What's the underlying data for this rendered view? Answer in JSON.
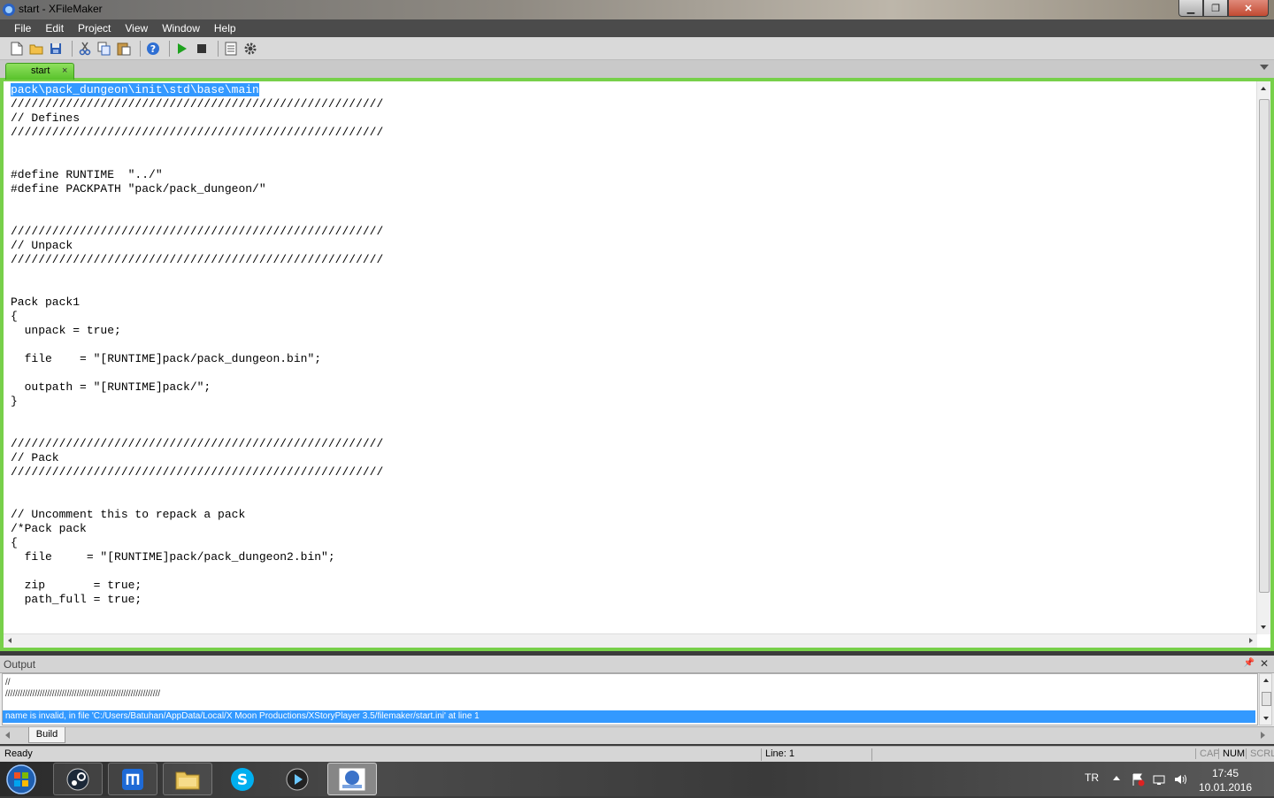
{
  "window": {
    "title": "start - XFileMaker",
    "controls": [
      "minimize",
      "maximize",
      "close"
    ]
  },
  "menu": [
    "File",
    "Edit",
    "Project",
    "View",
    "Window",
    "Help"
  ],
  "toolbar": {
    "icons": [
      "new-file-icon",
      "open-folder-icon",
      "save-icon",
      "cut-icon",
      "copy-icon",
      "paste-icon",
      "help-icon",
      "run-icon",
      "stop-icon",
      "file-list-icon",
      "settings-gear-icon"
    ],
    "run_color": "#1ea21e"
  },
  "tabs": [
    {
      "label": "start",
      "close": "×",
      "active": true
    }
  ],
  "editor": {
    "selected_line": "pack\\pack_dungeon\\init\\std\\base\\main",
    "lines": [
      "pack\\pack_dungeon\\init\\std\\base\\main",
      "//////////////////////////////////////////////////////",
      "// Defines",
      "//////////////////////////////////////////////////////",
      "",
      "",
      "#define RUNTIME  \"../\"",
      "#define PACKPATH \"pack/pack_dungeon/\"",
      "",
      "",
      "//////////////////////////////////////////////////////",
      "// Unpack",
      "//////////////////////////////////////////////////////",
      "",
      "",
      "Pack pack1",
      "{",
      "  unpack = true;",
      "",
      "  file    = \"[RUNTIME]pack/pack_dungeon.bin\";",
      "",
      "  outpath = \"[RUNTIME]pack/\";",
      "}",
      "",
      "",
      "//////////////////////////////////////////////////////",
      "// Pack",
      "//////////////////////////////////////////////////////",
      "",
      "",
      "// Uncomment this to repack a pack",
      "/*Pack pack",
      "{",
      "  file     = \"[RUNTIME]pack/pack_dungeon2.bin\";",
      "",
      "  zip       = true;",
      "  path_full = true;"
    ]
  },
  "output": {
    "title": "Output",
    "lines": [
      "//",
      "///////////////////////////////////////////////////////////////"
    ],
    "error": "name is invalid, in file 'C:/Users/Batuhan/AppData/Local/X Moon Productions/XStoryPlayer 3.5/filemaker/start.ini' at line 1",
    "tabs": [
      "Build"
    ]
  },
  "status": {
    "ready": "Ready",
    "line": "Line: 1",
    "cap": "CAP",
    "num": "NUM",
    "scrl": "SCRL"
  },
  "taskbar": {
    "apps": [
      "steam-icon",
      "maxthon-icon",
      "file-explorer-icon",
      "skype-icon",
      "media-player-icon",
      "xfilemaker-icon"
    ],
    "active_app": "xfilemaker-icon",
    "tray": {
      "lang": "TR",
      "time": "17:45",
      "date": "10.01.2016"
    }
  },
  "colors": {
    "accent_green": "#77d04a",
    "selection": "#3399ff",
    "menubar": "#4b4b4b"
  }
}
